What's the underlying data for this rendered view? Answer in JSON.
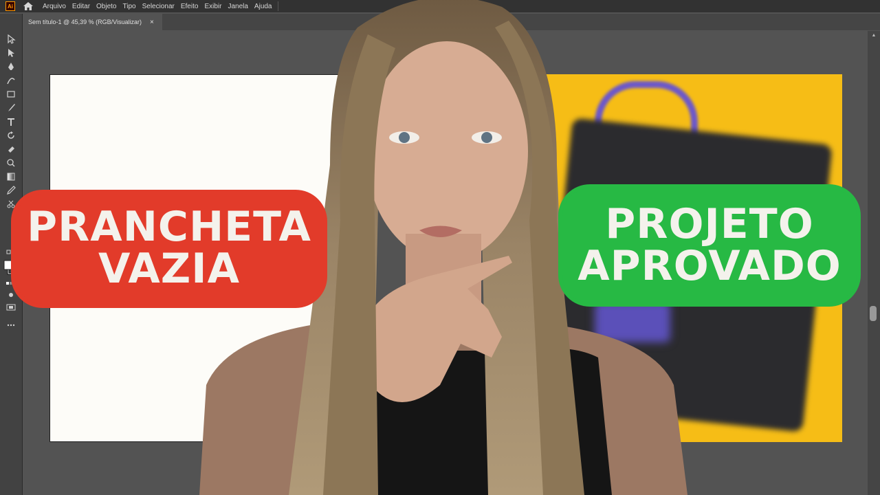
{
  "app": {
    "logo_text": "Ai",
    "menu": [
      "Arquivo",
      "Editar",
      "Objeto",
      "Tipo",
      "Selecionar",
      "Efeito",
      "Exibir",
      "Janela",
      "Ajuda"
    ]
  },
  "document": {
    "tab_title": "Sem título-1 @ 45,39 % (RGB/Visualizar)",
    "close_symbol": "×"
  },
  "tools": [
    "selection-tool-icon",
    "direct-selection-tool-icon",
    "pen-tool-icon",
    "curvature-tool-icon",
    "rectangle-tool-icon",
    "paintbrush-tool-icon",
    "type-tool-icon",
    "rotate-tool-icon",
    "eraser-tool-icon",
    "warp-tool-icon",
    "gradient-tool-icon",
    "eyedropper-tool-icon",
    "scissors-tool-icon"
  ],
  "overlay": {
    "left_label": [
      "PRANCHETA",
      "VAZIA"
    ],
    "right_label": [
      "PROJETO",
      "APROVADO"
    ]
  },
  "colors": {
    "left_label_bg": "#e23b2a",
    "right_label_bg": "#27b944",
    "artboard_yellow": "#f6bd16",
    "label_text": "#f4f2ec"
  }
}
